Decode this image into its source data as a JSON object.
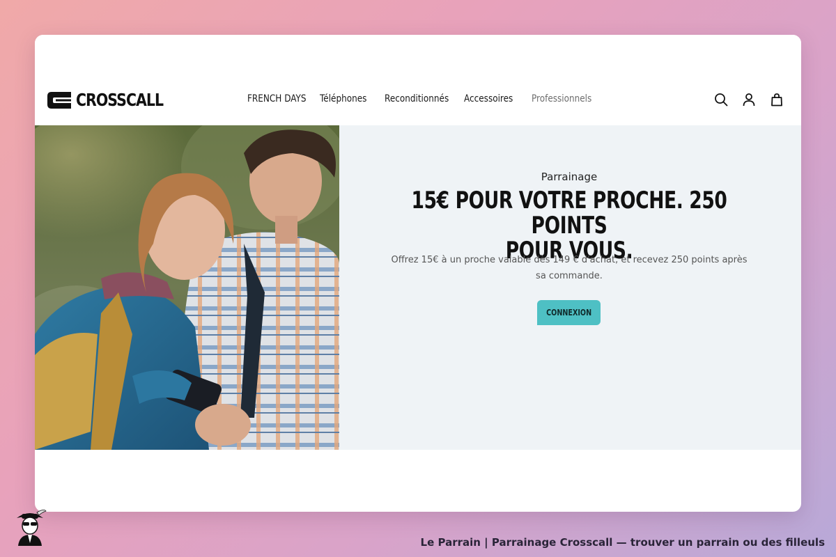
{
  "brand": {
    "name": "CROSSCALL"
  },
  "nav": {
    "items": [
      {
        "label": "FRENCH DAYS"
      },
      {
        "label": "Téléphones"
      },
      {
        "label": "Reconditionnés"
      },
      {
        "label": "Accessoires"
      },
      {
        "label": "Professionnels"
      }
    ]
  },
  "header_icons": [
    "search-icon",
    "account-icon",
    "bag-icon"
  ],
  "hero": {
    "eyebrow": "Parrainage",
    "headline_line1": "15€ POUR VOTRE PROCHE. 250 POINTS",
    "headline_line2": "POUR VOUS.",
    "subtext": "Offrez 15€ à un proche valable dès 149 € d'achat, et recevez 250 points après sa commande.",
    "cta_label": "CONNEXION",
    "image_alt": "Deux randonneurs regardant un smartphone"
  },
  "colors": {
    "accent": "#4ec0c4",
    "panel_bg": "#eff3f6",
    "text_dark": "#111111"
  },
  "footer": {
    "caption": "Le Parrain | Parrainage Crosscall — trouver un parrain ou des filleuls"
  }
}
